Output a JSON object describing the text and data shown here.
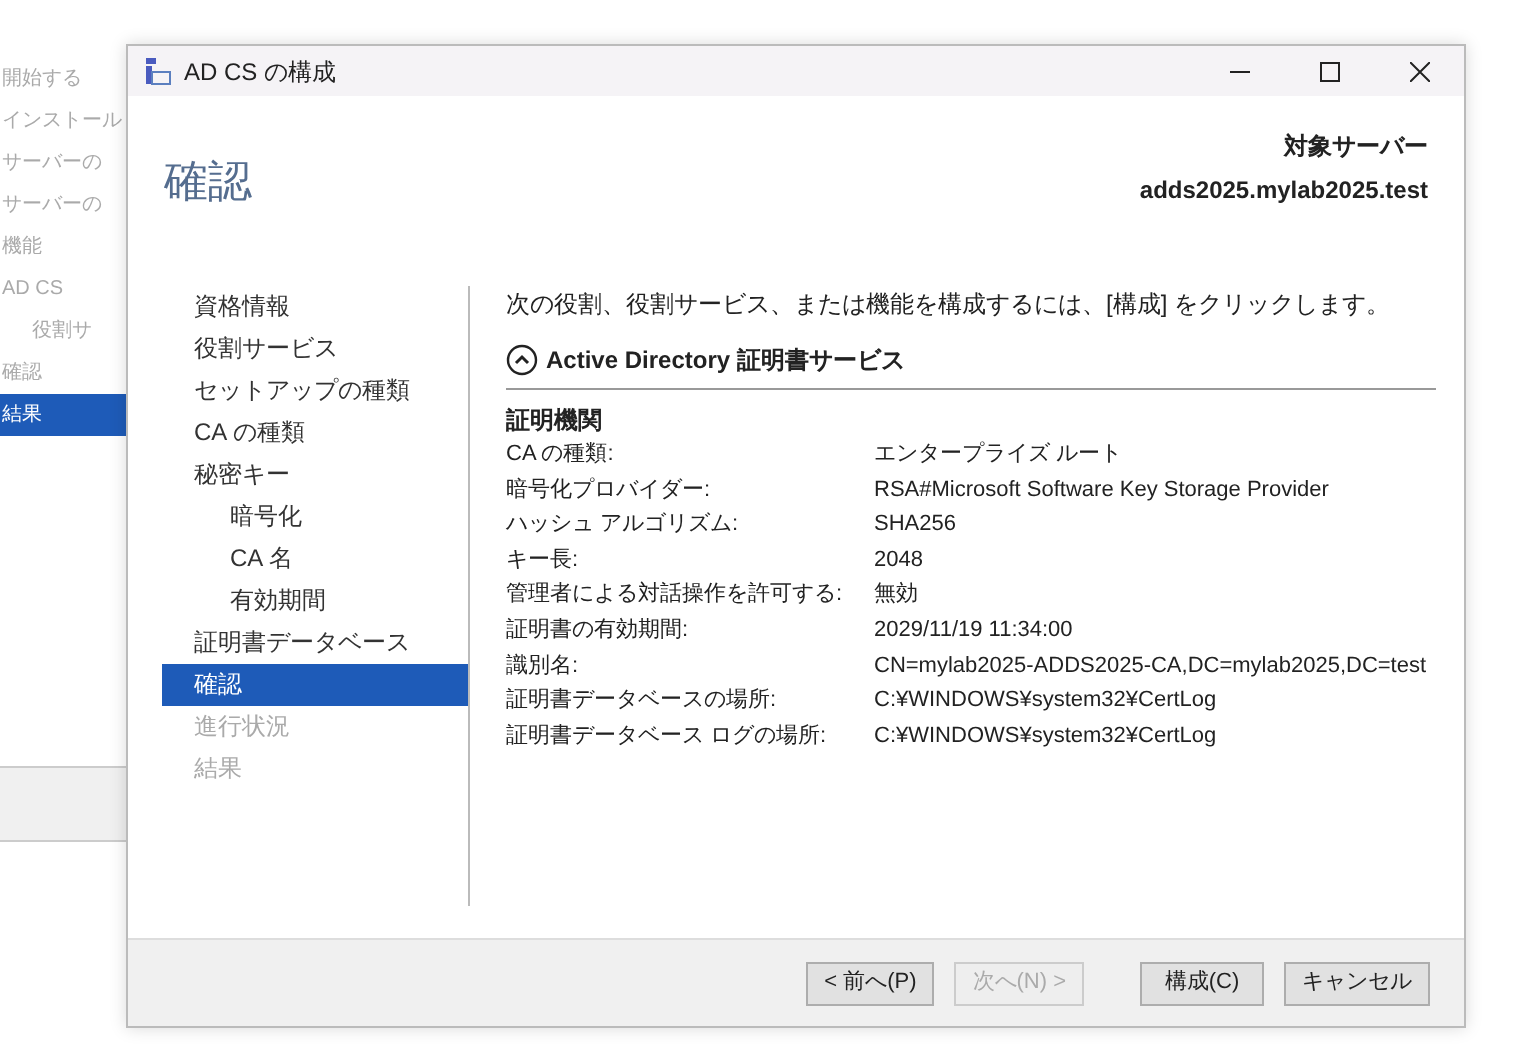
{
  "background_window": {
    "steps": [
      {
        "label": "開始する",
        "selected": false
      },
      {
        "label": "インストール",
        "selected": false
      },
      {
        "label": "サーバーの",
        "selected": false
      },
      {
        "label": "サーバーの",
        "selected": false
      },
      {
        "label": "機能",
        "selected": false
      },
      {
        "label": "AD CS",
        "selected": false
      },
      {
        "label": "役割サ",
        "selected": false,
        "indented": true
      },
      {
        "label": "確認",
        "selected": false
      },
      {
        "label": "結果",
        "selected": true
      }
    ]
  },
  "window": {
    "title": "AD CS の構成"
  },
  "page_title": "確認",
  "target_server": {
    "label": "対象サーバー",
    "name": "adds2025.mylab2025.test"
  },
  "steps": [
    {
      "label": "資格情報",
      "selected": false,
      "disabled": false
    },
    {
      "label": "役割サービス",
      "selected": false,
      "disabled": false
    },
    {
      "label": "セットアップの種類",
      "selected": false,
      "disabled": false
    },
    {
      "label": "CA の種類",
      "selected": false,
      "disabled": false
    },
    {
      "label": "秘密キー",
      "selected": false,
      "disabled": false,
      "children": [
        {
          "label": "暗号化",
          "selected": false,
          "disabled": false
        },
        {
          "label": "CA 名",
          "selected": false,
          "disabled": false
        },
        {
          "label": "有効期間",
          "selected": false,
          "disabled": false
        }
      ]
    },
    {
      "label": "証明書データベース",
      "selected": false,
      "disabled": false
    },
    {
      "label": "確認",
      "selected": true,
      "disabled": false
    },
    {
      "label": "進行状況",
      "selected": false,
      "disabled": true
    },
    {
      "label": "結果",
      "selected": false,
      "disabled": true
    }
  ],
  "intro": "次の役割、役割サービス、または機能を構成するには、[構成] をクリックします。",
  "section": {
    "title": "Active Directory 証明書サービス",
    "expanded": true
  },
  "group_title": "証明機関",
  "details": [
    {
      "label": "CA の種類:",
      "value": "エンタープライズ ルート"
    },
    {
      "label": "暗号化プロバイダー:",
      "value": "RSA#Microsoft Software Key Storage Provider"
    },
    {
      "label": "ハッシュ アルゴリズム:",
      "value": "SHA256"
    },
    {
      "label": "キー長:",
      "value": "2048"
    },
    {
      "label": "管理者による対話操作を許可する:",
      "value": "無効"
    },
    {
      "label": "証明書の有効期間:",
      "value": "2029/11/19 11:34:00"
    },
    {
      "label": "識別名:",
      "value": "CN=mylab2025-ADDS2025-CA,DC=mylab2025,DC=test"
    },
    {
      "label": "証明書データベースの場所:",
      "value": "C:¥WINDOWS¥system32¥CertLog"
    },
    {
      "label": "証明書データベース ログの場所:",
      "value": "C:¥WINDOWS¥system32¥CertLog"
    }
  ],
  "buttons": [
    {
      "label": "< 前へ(P)",
      "disabled": false
    },
    {
      "label": "次へ(N) >",
      "disabled": true
    },
    {
      "label": "構成(C)",
      "disabled": false
    },
    {
      "label": "キャンセル",
      "disabled": false
    }
  ]
}
